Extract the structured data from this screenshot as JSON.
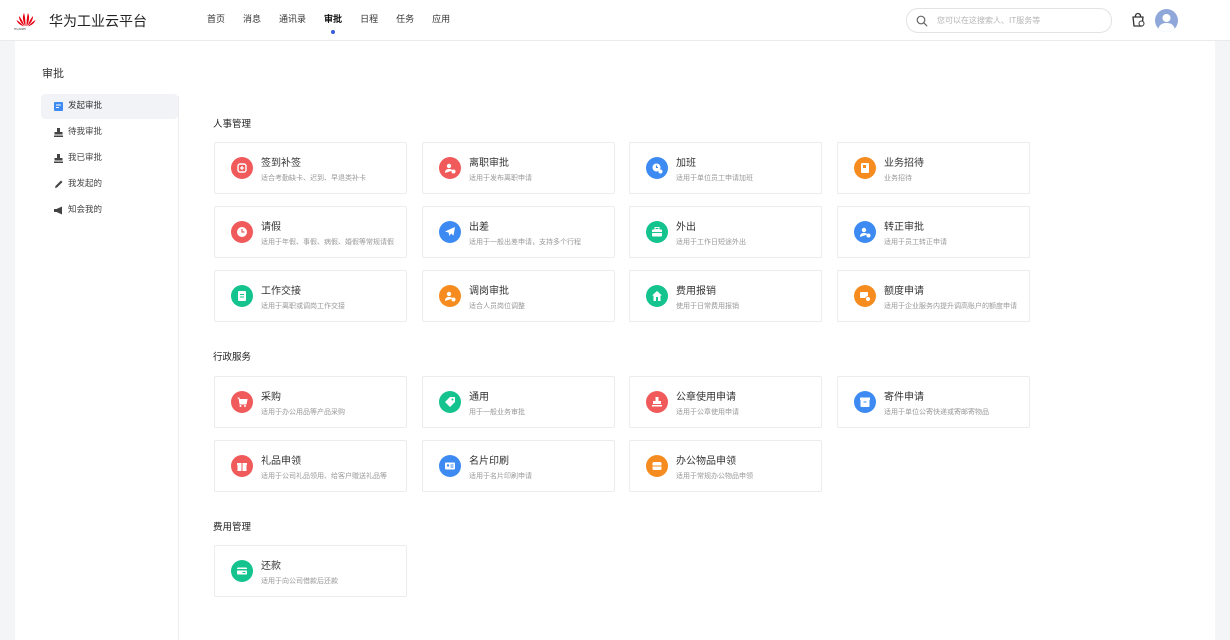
{
  "header": {
    "logo_text": "HUAWEI",
    "app_title": "华为工业云平台",
    "nav": [
      {
        "label": "首页"
      },
      {
        "label": "消息"
      },
      {
        "label": "通讯录"
      },
      {
        "label": "审批",
        "active": true
      },
      {
        "label": "日程"
      },
      {
        "label": "任务"
      },
      {
        "label": "应用"
      }
    ],
    "search_placeholder": "您可以在这搜索人、IT服务等"
  },
  "page": {
    "title": "审批"
  },
  "sidebar": {
    "items": [
      {
        "label": "发起审批",
        "icon": "form-icon",
        "active": true
      },
      {
        "label": "待我审批",
        "icon": "stamp-icon"
      },
      {
        "label": "我已审批",
        "icon": "stamp-done-icon"
      },
      {
        "label": "我发起的",
        "icon": "pen-icon"
      },
      {
        "label": "知会我的",
        "icon": "megaphone-icon"
      }
    ]
  },
  "sections": [
    {
      "title": "人事管理",
      "cards": [
        {
          "title": "签到补签",
          "desc": "适合考勤缺卡、迟到、早退类补卡",
          "color": "#f15a5a",
          "icon": "sign-in-icon"
        },
        {
          "title": "离职审批",
          "desc": "适用于发布离职申请",
          "color": "#f15a5a",
          "icon": "user-leave-icon"
        },
        {
          "title": "加班",
          "desc": "适用于单位员工申请加班",
          "color": "#3d8bf2",
          "icon": "overtime-icon"
        },
        {
          "title": "业务招待",
          "desc": "业务招待",
          "color": "#f68c1f",
          "icon": "hospitality-icon"
        },
        {
          "title": "请假",
          "desc": "适用于年假、事假、病假、婚假等常规请假",
          "color": "#f15a5a",
          "icon": "clock-icon"
        },
        {
          "title": "出差",
          "desc": "适用于一般出差申请，支持多个行程",
          "color": "#3d8bf2",
          "icon": "airplane-icon"
        },
        {
          "title": "外出",
          "desc": "适用于工作日短途外出",
          "color": "#14c38e",
          "icon": "briefcase-icon"
        },
        {
          "title": "转正审批",
          "desc": "适用于员工转正申请",
          "color": "#3d8bf2",
          "icon": "user-check-icon"
        },
        {
          "title": "工作交接",
          "desc": "适用于离职或调岗工作交接",
          "color": "#14c38e",
          "icon": "document-icon"
        },
        {
          "title": "调岗审批",
          "desc": "适合人员岗位调整",
          "color": "#f68c1f",
          "icon": "user-transfer-icon"
        },
        {
          "title": "费用报销",
          "desc": "使用于日常费用报销",
          "color": "#14c38e",
          "icon": "home-icon"
        },
        {
          "title": "额度申请",
          "desc": "适用于企业服务内提升调高账户的额度申请",
          "color": "#f68c1f",
          "icon": "quota-icon"
        }
      ]
    },
    {
      "title": "行政服务",
      "cards": [
        {
          "title": "采购",
          "desc": "适用于办公用品等产品采购",
          "color": "#f15a5a",
          "icon": "cart-icon"
        },
        {
          "title": "通用",
          "desc": "用于一般业务审批",
          "color": "#14c38e",
          "icon": "tag-icon"
        },
        {
          "title": "公章使用申请",
          "desc": "适用于公章使用申请",
          "color": "#f15a5a",
          "icon": "seal-icon"
        },
        {
          "title": "寄件申请",
          "desc": "适用于单位公寄快递或寄邮寄物品",
          "color": "#3d8bf2",
          "icon": "package-icon"
        },
        {
          "title": "礼品申领",
          "desc": "适用于公司礼品领用、给客户赠送礼品等",
          "color": "#f15a5a",
          "icon": "gift-icon"
        },
        {
          "title": "名片印刷",
          "desc": "适用于名片印刷申请",
          "color": "#3d8bf2",
          "icon": "card-icon"
        },
        {
          "title": "办公物品申领",
          "desc": "适用于常规办公物品申领",
          "color": "#f68c1f",
          "icon": "box-icon"
        }
      ]
    },
    {
      "title": "费用管理",
      "cards": [
        {
          "title": "还款",
          "desc": "适用于向公司借款后还款",
          "color": "#14c38e",
          "icon": "repay-icon"
        }
      ]
    }
  ]
}
